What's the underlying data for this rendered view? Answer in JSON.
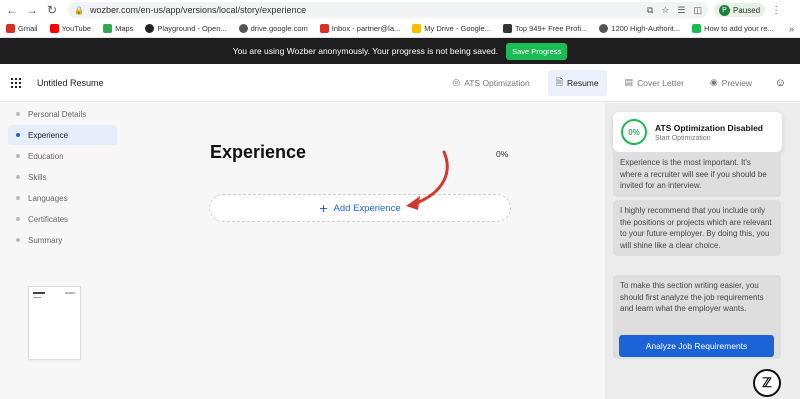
{
  "browser": {
    "url": "wozber.com/en-us/app/versions/local/story/experience",
    "profile_initial": "P",
    "profile_status": "Paused"
  },
  "bookmarks": [
    {
      "label": "Gmail",
      "icon": "gmail-icon",
      "color": "#d93025"
    },
    {
      "label": "YouTube",
      "icon": "youtube-icon",
      "color": "#ff0000"
    },
    {
      "label": "Maps",
      "icon": "maps-icon",
      "color": "#34a853"
    },
    {
      "label": "Playground - Open...",
      "icon": "openai-icon",
      "color": "#222222"
    },
    {
      "label": "drive.google.com",
      "icon": "globe-icon",
      "color": "#555555"
    },
    {
      "label": "Inbox - partner@la...",
      "icon": "gmail-icon",
      "color": "#d93025"
    },
    {
      "label": "My Drive - Google...",
      "icon": "drive-icon",
      "color": "#fbbc04"
    },
    {
      "label": "Top 949+ Free Profi...",
      "icon": "site-icon",
      "color": "#333333"
    },
    {
      "label": "1200 High-Authorit...",
      "icon": "globe-icon",
      "color": "#555555"
    },
    {
      "label": "How to add your re...",
      "icon": "bolt-icon",
      "color": "#1dbb55"
    }
  ],
  "notice": {
    "text": "You are using Wozber anonymously. Your progress is not being saved.",
    "button": "Save Progress"
  },
  "header": {
    "title": "Untitled Resume",
    "tabs": [
      {
        "label": "ATS Optimization",
        "icon": "target-icon",
        "active": false
      },
      {
        "label": "Resume",
        "icon": "document-icon",
        "active": true
      },
      {
        "label": "Cover Letter",
        "icon": "letter-icon",
        "active": false
      },
      {
        "label": "Preview",
        "icon": "eye-icon",
        "active": false
      }
    ]
  },
  "sidebar": {
    "items": [
      {
        "label": "Personal Details",
        "active": false
      },
      {
        "label": "Experience",
        "active": true
      },
      {
        "label": "Education",
        "active": false
      },
      {
        "label": "Skills",
        "active": false
      },
      {
        "label": "Languages",
        "active": false
      },
      {
        "label": "Certificates",
        "active": false
      },
      {
        "label": "Summary",
        "active": false
      }
    ]
  },
  "main": {
    "section_title": "Experience",
    "progress": "0%",
    "add_button": "Add Experience"
  },
  "ats": {
    "score": "0%",
    "title": "ATS Optimization Disabled",
    "subtitle": "Start Optimization"
  },
  "tips": [
    "Experience is the most important. It's where a recruiter will see if you should be invited for an interview.",
    "I highly recommend that you include only the positions or projects which are relevant to your future employer. By doing this, you will shine like a clear choice.",
    "To make this section writing easier, you should first analyze the job requirements and learn what the employer wants."
  ],
  "analyze_button": "Analyze Job Requirements",
  "colors": {
    "accent": "#1c63d8",
    "success": "#1dbb55",
    "annotation_arrow": "#d33a2c"
  }
}
